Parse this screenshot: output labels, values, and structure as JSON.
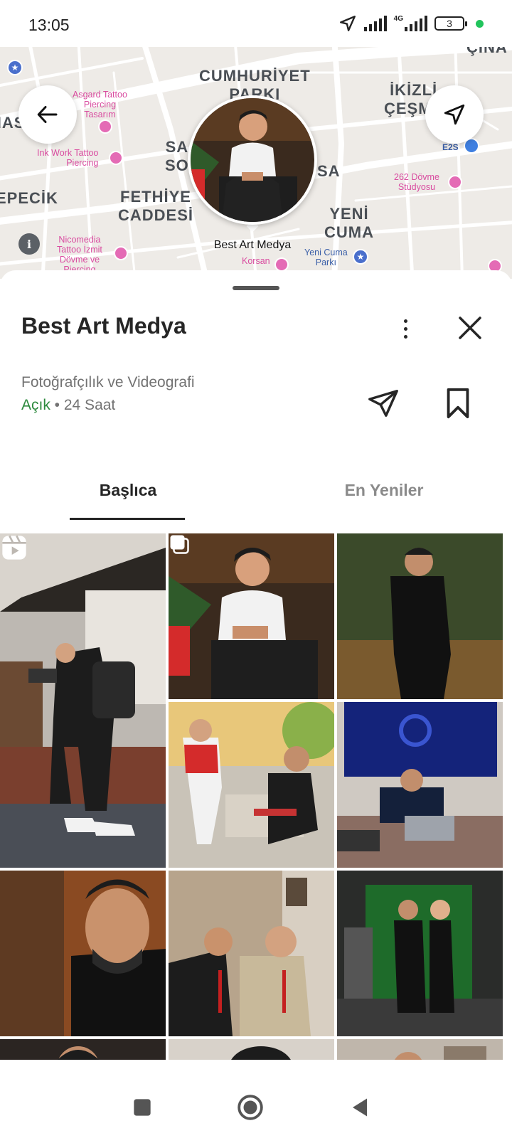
{
  "status_bar": {
    "time": "13:05",
    "network_label": "4G",
    "battery_level": "3",
    "icons": [
      "location-arrow-icon",
      "signal-icon",
      "signal-4g-icon",
      "battery-icon",
      "green-dot-indicator"
    ]
  },
  "map": {
    "labels": {
      "cumhuriyet": "CUMHURİYET\nPARKI",
      "ikizli": "İKİZLİ\nÇEŞME",
      "cinar": "ÇINA",
      "has": "HAS",
      "sa": "SA\nSO",
      "sa2": "SA",
      "epecik": "EPECİK",
      "fethiye": "FETHİYE\nCADDESİ",
      "yeni_cuma": "YENİ\nCUMA"
    },
    "pois": {
      "asgard": "Asgard Tattoo\nPiercing\nTasarım",
      "inkwork": "Ink Work Tattoo\nPiercing",
      "dovme262": "262 Dövme\nStüdyosu",
      "nicomedia": "Nicomedia\nTattoo İzmit\nDövme ve\nPiercing",
      "korsan": "Korsan"
    },
    "parks": {
      "yeni_cuma_parki": "Yeni Cuma\nParkı"
    },
    "fuel": "E2S",
    "pin_label": "Best Art Medya",
    "info": "i"
  },
  "business": {
    "name": "Best Art Medya",
    "category": "Fotoğrafçılık ve Videografi",
    "open_label": "Açık",
    "hours": " • 24 Saat"
  },
  "tabs": {
    "main": "Başlıca",
    "recent": "En Yeniler"
  },
  "colors": {
    "open_green": "#2d8a3e",
    "poi_pink": "#d94ca0",
    "map_bg": "#eeebe7",
    "text_dark": "#262626"
  }
}
